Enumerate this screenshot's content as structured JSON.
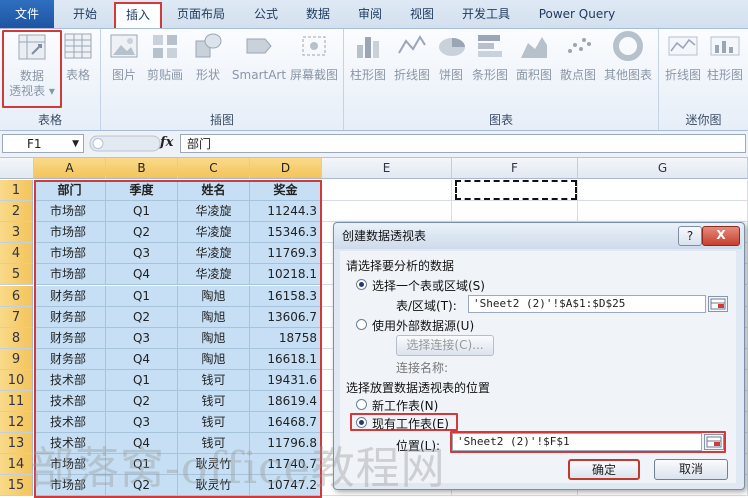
{
  "tabs": [
    "文件",
    "开始",
    "插入",
    "页面布局",
    "公式",
    "数据",
    "审阅",
    "视图",
    "开发工具",
    "Power Query"
  ],
  "ribbon": {
    "groups": [
      {
        "label": "表格",
        "buttons": [
          "数据\n透视表",
          "表格"
        ]
      },
      {
        "label": "插图",
        "buttons": [
          "图片",
          "剪贴画",
          "形状",
          "SmartArt",
          "屏幕截图"
        ]
      },
      {
        "label": "图表",
        "buttons": [
          "柱形图",
          "折线图",
          "饼图",
          "条形图",
          "面积图",
          "散点图",
          "其他图表"
        ]
      },
      {
        "label": "迷你图",
        "buttons": [
          "折线图",
          "柱形图"
        ]
      }
    ]
  },
  "formula_bar": {
    "name_box": "F1",
    "fx": "fx",
    "content": "部门"
  },
  "columns": [
    "A",
    "B",
    "C",
    "D",
    "E",
    "F",
    "G"
  ],
  "table": {
    "headers": [
      "部门",
      "季度",
      "姓名",
      "奖金"
    ],
    "rows": [
      [
        "市场部",
        "Q1",
        "华凌旋",
        "11244.3"
      ],
      [
        "市场部",
        "Q2",
        "华凌旋",
        "15346.3"
      ],
      [
        "市场部",
        "Q3",
        "华凌旋",
        "11769.3"
      ],
      [
        "市场部",
        "Q4",
        "华凌旋",
        "10218.1"
      ],
      [
        "财务部",
        "Q1",
        "陶旭",
        "16158.3"
      ],
      [
        "财务部",
        "Q2",
        "陶旭",
        "13606.7"
      ],
      [
        "财务部",
        "Q3",
        "陶旭",
        "18758"
      ],
      [
        "财务部",
        "Q4",
        "陶旭",
        "16618.1"
      ],
      [
        "技术部",
        "Q1",
        "钱可",
        "19431.6"
      ],
      [
        "技术部",
        "Q2",
        "钱可",
        "18619.4"
      ],
      [
        "技术部",
        "Q3",
        "钱可",
        "16468.7"
      ],
      [
        "技术部",
        "Q4",
        "钱可",
        "11796.8"
      ],
      [
        "市场部",
        "Q1",
        "耿灵竹",
        "11740.7"
      ],
      [
        "市场部",
        "Q2",
        "耿灵竹",
        "10747.2"
      ]
    ]
  },
  "row_numbers": [
    "1",
    "2",
    "3",
    "4",
    "5",
    "6",
    "7",
    "8",
    "9",
    "10",
    "11",
    "12",
    "13",
    "14",
    "15"
  ],
  "dialog": {
    "title": "创建数据透视表",
    "help": "?",
    "close": "X",
    "section1": "请选择要分析的数据",
    "opt_table": "选择一个表或区域(S)",
    "range_label": "表/区域(T):",
    "range_value": "'Sheet2 (2)'!$A$1:$D$25",
    "opt_external": "使用外部数据源(U)",
    "choose_conn": "选择连接(C)...",
    "conn_name": "连接名称:",
    "section2": "选择放置数据透视表的位置",
    "opt_new": "新工作表(N)",
    "opt_existing": "现有工作表(E)",
    "loc_label": "位置(L):",
    "loc_value": "'Sheet2 (2)'!$F$1",
    "ok": "确定",
    "cancel": "取消"
  },
  "watermark": "部落窝-office教程网",
  "colors": {
    "accent": "#d23a3a",
    "selection": "#c6dff4",
    "file_tab": "#2f6fbf"
  }
}
